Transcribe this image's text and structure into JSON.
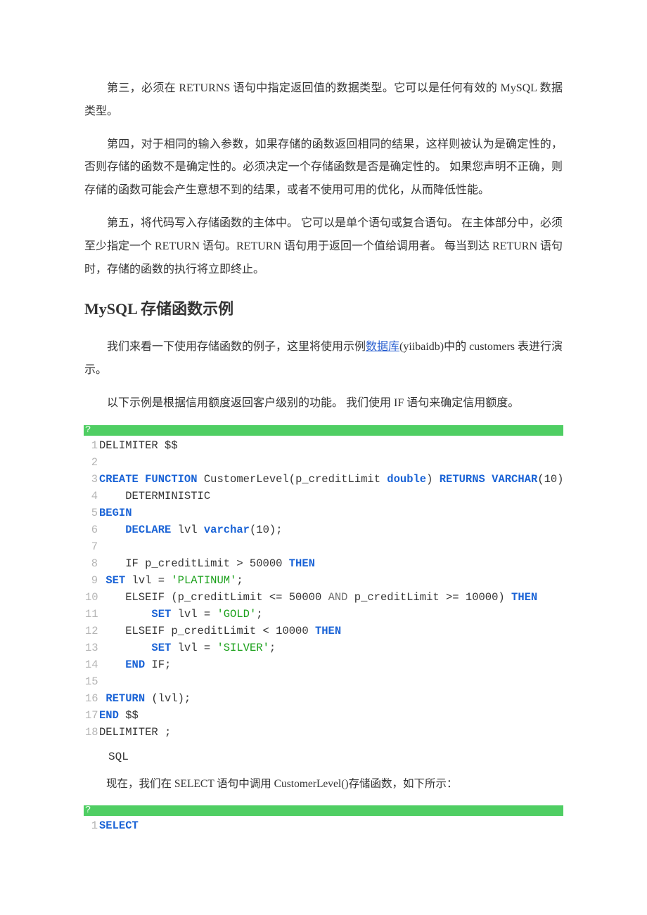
{
  "paras": {
    "p1": "第三，必须在 RETURNS 语句中指定返回值的数据类型。它可以是任何有效的 MySQL 数据类型。",
    "p2": "第四，对于相同的输入参数，如果存储的函数返回相同的结果，这样则被认为是确定性的，否则存储的函数不是确定性的。必须决定一个存储函数是否是确定性的。  如果您声明不正确，则存储的函数可能会产生意想不到的结果，或者不使用可用的优化，从而降低性能。",
    "p3": "第五，将代码写入存储函数的主体中。 它可以是单个语句或复合语句。 在主体部分中，必须至少指定一个 RETURN 语句。RETURN 语句用于返回一个值给调用者。  每当到达 RETURN 语句时，存储的函数的执行将立即终止。"
  },
  "heading": "MySQL 存储函数示例",
  "intro": {
    "pre": "我们来看一下使用存储函数的例子，这里将使用示例",
    "link": "数据库",
    "post": "(yiibaidb)中的 customers 表进行演示。"
  },
  "intro2": "以下示例是根据信用额度返回客户级别的功能。  我们使用 IF 语句来确定信用额度。",
  "code1_bar": "?",
  "code1": {
    "gutter": [
      "1",
      "2",
      "3",
      "4",
      "5",
      "6",
      "7",
      "8",
      "9",
      "10",
      "11",
      "12",
      "13",
      "14",
      "15",
      "16",
      "17",
      "18"
    ],
    "l1_a": "DELIMITER $$",
    "l3_a": "CREATE",
    "l3_b": " ",
    "l3_c": "FUNCTION",
    "l3_d": " CustomerLevel(p_creditLimit ",
    "l3_e": "double",
    "l3_f": ") ",
    "l3_g": "RETURNS",
    "l3_h": " ",
    "l3_i": "VARCHAR",
    "l3_j": "(10)",
    "l4": "    DETERMINISTIC",
    "l5": "BEGIN",
    "l6_a": "    ",
    "l6_b": "DECLARE",
    "l6_c": " lvl ",
    "l6_d": "varchar",
    "l6_e": "(10);",
    "l8_a": "    IF p_creditLimit > 50000 ",
    "l8_b": "THEN",
    "l9_a": " ",
    "l9_b": "SET",
    "l9_c": " lvl = ",
    "l9_d": "'PLATINUM'",
    "l9_e": ";",
    "l10_a": "    ELSEIF (p_creditLimit <= 50000 ",
    "l10_b": "AND",
    "l10_c": " p_creditLimit >= 10000) ",
    "l10_d": "THEN",
    "l11_a": "        ",
    "l11_b": "SET",
    "l11_c": " lvl = ",
    "l11_d": "'GOLD'",
    "l11_e": ";",
    "l12_a": "    ELSEIF p_creditLimit < 10000 ",
    "l12_b": "THEN",
    "l13_a": "        ",
    "l13_b": "SET",
    "l13_c": " lvl = ",
    "l13_d": "'SILVER'",
    "l13_e": ";",
    "l14_a": "    ",
    "l14_b": "END",
    "l14_c": " IF;",
    "l16_a": " ",
    "l16_b": "RETURN",
    "l16_c": " (lvl);",
    "l17_a": "END",
    "l17_b": " $$",
    "l18": "DELIMITER ;"
  },
  "sql_label": "SQL",
  "after_code": "现在，我们在 SELECT 语句中调用 CustomerLevel()存储函数，如下所示：",
  "code2_bar": "?",
  "code2": {
    "gutter": [
      "1"
    ],
    "l1": "SELECT"
  }
}
